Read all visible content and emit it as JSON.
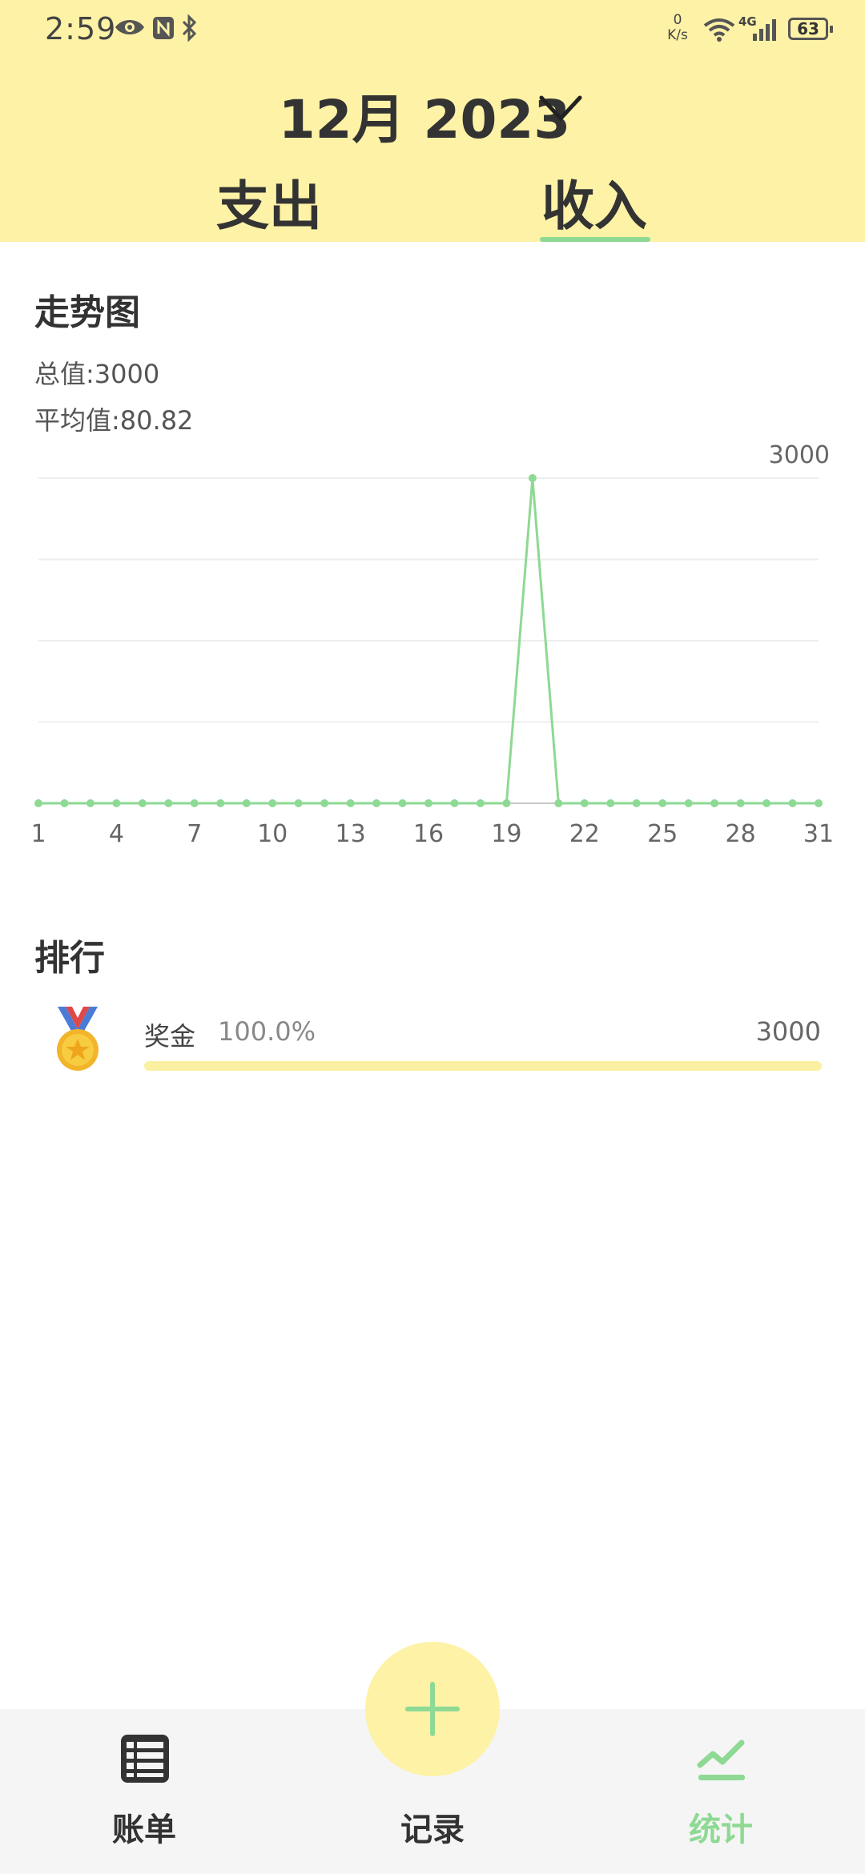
{
  "status_bar": {
    "time": "2:59",
    "net_speed_value": "0",
    "net_speed_unit": "K/s",
    "network_type": "4G",
    "battery": "63",
    "icons": [
      "eye-icon",
      "nfc-icon",
      "bluetooth-icon",
      "wifi-icon",
      "signal-icon",
      "battery-icon"
    ]
  },
  "header": {
    "month_label": "12月 2023",
    "tabs": [
      {
        "label": "支出",
        "active": false
      },
      {
        "label": "收入",
        "active": true
      }
    ]
  },
  "trend": {
    "title": "走势图",
    "total_label": "总值:",
    "total_value": "3000",
    "avg_label": "平均值:",
    "avg_value": "80.82"
  },
  "chart_data": {
    "type": "line",
    "title": "走势图",
    "x": [
      1,
      2,
      3,
      4,
      5,
      6,
      7,
      8,
      9,
      10,
      11,
      12,
      13,
      14,
      15,
      16,
      17,
      18,
      19,
      20,
      21,
      22,
      23,
      24,
      25,
      26,
      27,
      28,
      29,
      30,
      31
    ],
    "values": [
      0,
      0,
      0,
      0,
      0,
      0,
      0,
      0,
      0,
      0,
      0,
      0,
      0,
      0,
      0,
      0,
      0,
      0,
      0,
      3000,
      0,
      0,
      0,
      0,
      0,
      0,
      0,
      0,
      0,
      0,
      0
    ],
    "x_tick_labels": [
      "1",
      "4",
      "7",
      "10",
      "13",
      "16",
      "19",
      "22",
      "25",
      "28",
      "31"
    ],
    "max_label": "3000",
    "ylim": [
      0,
      3000
    ],
    "grid": true,
    "line_color": "#8ed993"
  },
  "ranking": {
    "title": "排行",
    "items": [
      {
        "name": "奖金",
        "percent": "100.0%",
        "value": "3000",
        "fraction": 1.0,
        "icon": "medal-icon"
      }
    ]
  },
  "nav": {
    "bills_label": "账单",
    "record_label": "记录",
    "stats_label": "统计",
    "active_color": "#8ed993"
  }
}
